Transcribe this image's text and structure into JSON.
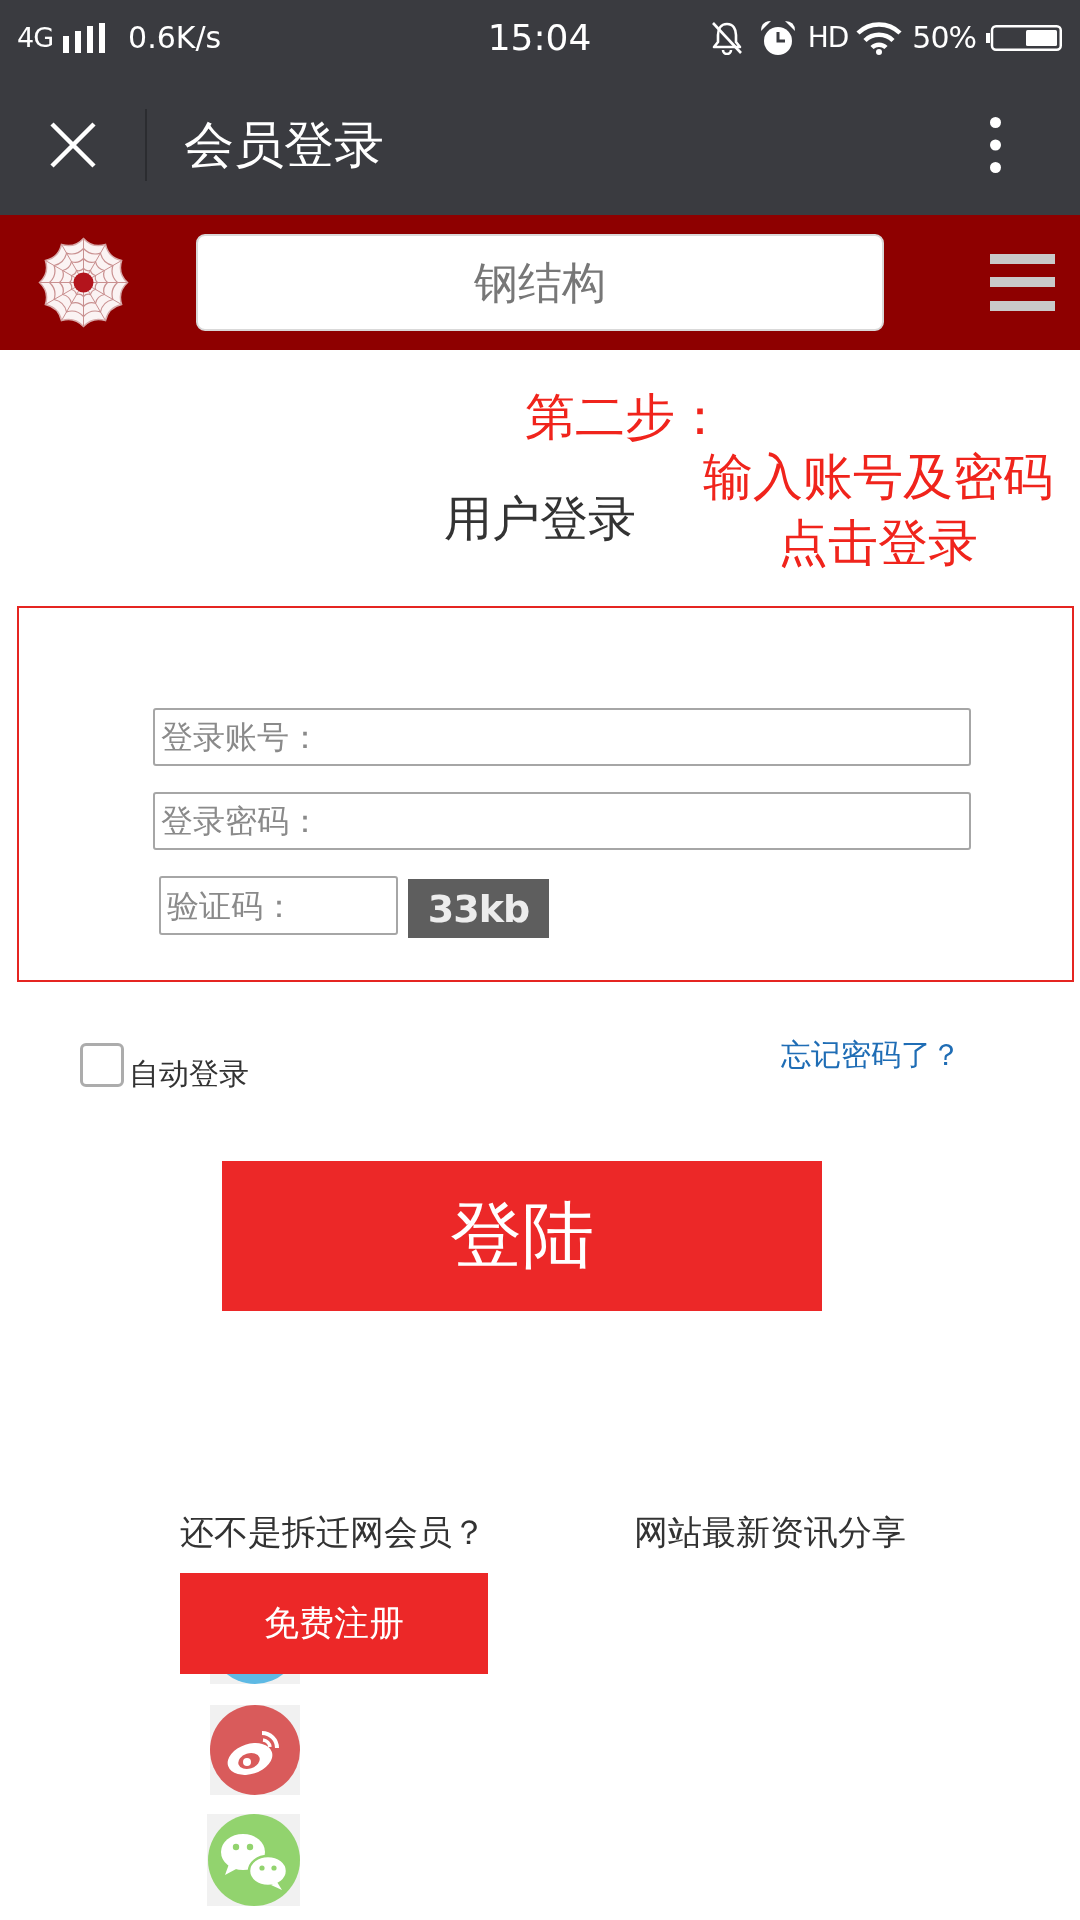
{
  "status_bar": {
    "network": "4G",
    "speed": "0.6K/s",
    "time": "15:04",
    "hd": "HD",
    "battery": "50%"
  },
  "title_bar": {
    "title": "会员登录"
  },
  "header": {
    "search": {
      "placeholder": "钢结构"
    }
  },
  "annotation": {
    "step": "第二步：",
    "lines": [
      "输入账号及密码",
      "点击登录"
    ]
  },
  "login": {
    "title": "用户登录",
    "fields": [
      {
        "kind": "text",
        "placeholder": "登录账号："
      },
      {
        "kind": "password",
        "placeholder": "登录密码："
      },
      {
        "kind": "captcha",
        "placeholder": "验证码：",
        "code": "33kb"
      }
    ],
    "remember": {
      "label": "自动登录",
      "checked": false
    },
    "forgot_link": "忘记密码了？",
    "submit": "登陆"
  },
  "footer": {
    "prompt": "还不是拆迁网会员？",
    "register": "免费注册",
    "share_title": "网站最新资讯分享",
    "share_icons": [
      {
        "kind": "partial"
      },
      {
        "kind": "swirl"
      },
      {
        "kind": "chat"
      }
    ]
  }
}
